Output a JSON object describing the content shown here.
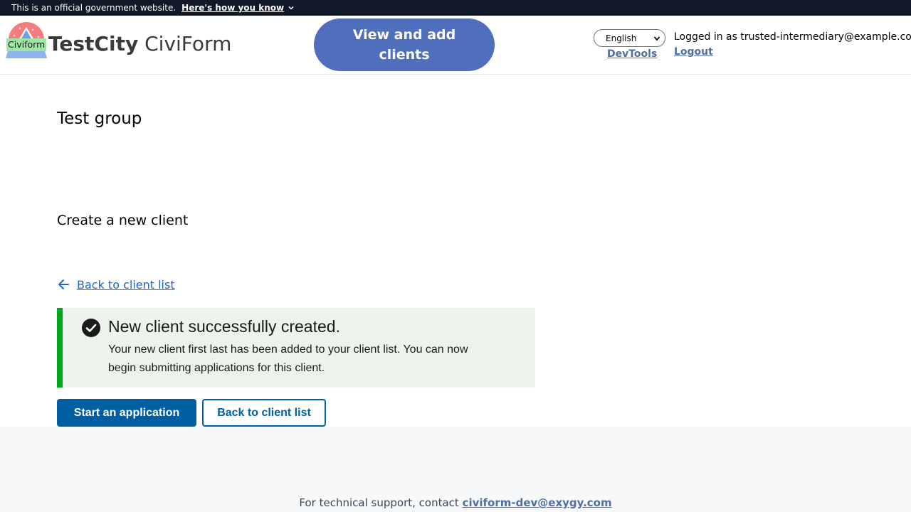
{
  "gov_banner": {
    "text": "This is an official government website.",
    "how_link": "Here's how you know"
  },
  "header": {
    "logo_text": "Civiform",
    "brand_strong": "TestCity",
    "brand_light": "CiviForm",
    "view_clients_button": "View and add clients",
    "language": {
      "selected": "English"
    },
    "devtools_link": "DevTools",
    "logged_in_text": "Logged in as trusted-intermediary@example.com",
    "logout_link": "Logout"
  },
  "main": {
    "group_title": "Test group",
    "section_title": "Create a new client",
    "back_link": "Back to client list",
    "alert": {
      "heading": "New client successfully created.",
      "body": "Your new client first last has been added to your client list. You can now begin submitting applications for this client."
    },
    "start_button": "Start an application",
    "back_button": "Back to client list"
  },
  "footer": {
    "support_text": "For technical support, contact",
    "support_email": "civiform-dev@exygy.com"
  },
  "colors": {
    "banner_bg": "#111827",
    "nav_button": "#4f6ebb",
    "primary": "#005ea2",
    "success_border": "#00a91c",
    "success_bg": "#ecf3ec",
    "link": "#2563c9"
  }
}
